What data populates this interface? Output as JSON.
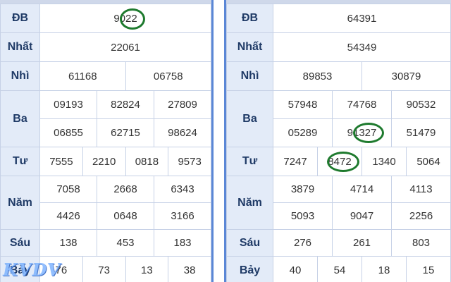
{
  "labels": {
    "db": "ĐB",
    "nhat": "Nhất",
    "nhi": "Nhì",
    "ba": "Ba",
    "tu": "Tư",
    "nam": "Năm",
    "sau": "Sáu",
    "bay": "Bảy"
  },
  "left": {
    "db_prefix": "90",
    "db_circled": "22",
    "nhat": "22061",
    "nhi": [
      "61168",
      "06758"
    ],
    "ba": [
      "09193",
      "82824",
      "27809",
      "06855",
      "62715",
      "98624"
    ],
    "tu": [
      "7555",
      "2210",
      "0818",
      "9573"
    ],
    "nam": [
      "7058",
      "2668",
      "6343",
      "4426",
      "0648",
      "3166"
    ],
    "sau": [
      "138",
      "453",
      "183"
    ],
    "bay": [
      "76",
      "73",
      "13",
      "38"
    ]
  },
  "right": {
    "db": "64391",
    "nhat": "54349",
    "nhi": [
      "89853",
      "30879"
    ],
    "ba": [
      "57948",
      "74768",
      "90532",
      "05289",
      "91327",
      "51479"
    ],
    "ba_4_prefix": "91",
    "ba_4_circled": "327",
    "tu": [
      "7247",
      "8472",
      "1340",
      "5064"
    ],
    "tu_1_prefix": "8",
    "tu_1_circled": "472",
    "nam": [
      "3879",
      "4714",
      "4113",
      "5093",
      "9047",
      "2256"
    ],
    "sau": [
      "276",
      "261",
      "803"
    ],
    "bay": [
      "40",
      "54",
      "18",
      "15"
    ]
  },
  "watermark": {
    "logo_text": "KVDV"
  },
  "colors": {
    "special": "#e3161b",
    "label_bg": "#e3ebf8",
    "circle": "#1e7a2e",
    "frame": "#5b87d6"
  }
}
